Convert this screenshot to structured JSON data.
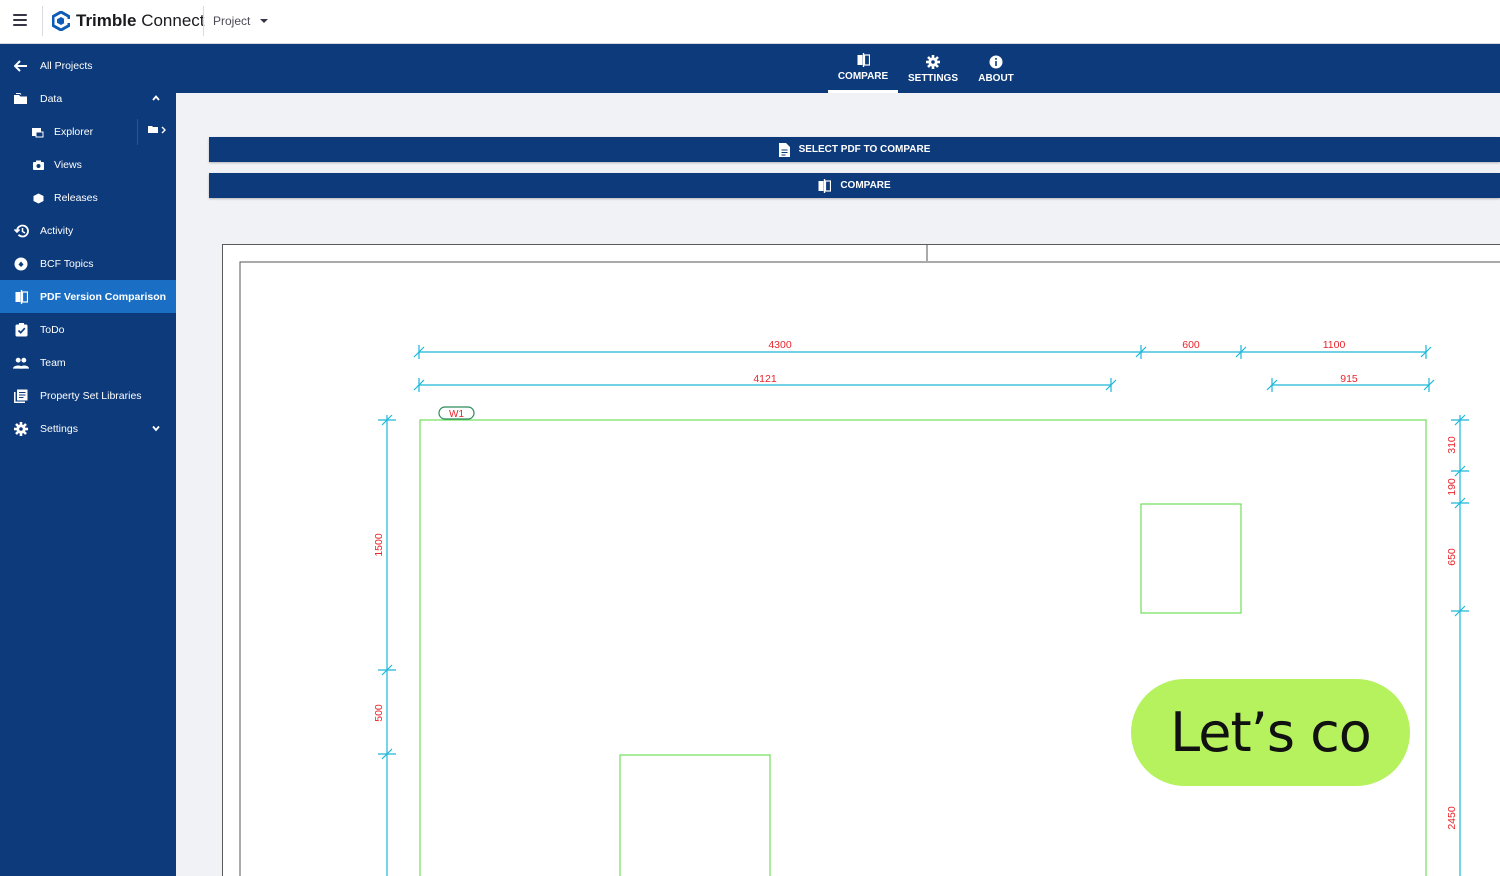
{
  "header": {
    "brand_strong": "Trimble",
    "brand_light": " Connect",
    "project_label": "Project"
  },
  "sidebar": {
    "items": [
      {
        "label": "All Projects",
        "icon": "arrow-left-icon"
      },
      {
        "label": "Data",
        "icon": "folder-icon"
      },
      {
        "label": "Explorer",
        "icon": "explorer-icon"
      },
      {
        "label": "Views",
        "icon": "camera-icon"
      },
      {
        "label": "Releases",
        "icon": "box-icon"
      },
      {
        "label": "Activity",
        "icon": "history-icon"
      },
      {
        "label": "BCF Topics",
        "icon": "bcf-icon"
      },
      {
        "label": "PDF Version Comparison",
        "icon": "compare-icon"
      },
      {
        "label": "ToDo",
        "icon": "checkbox-icon"
      },
      {
        "label": "Team",
        "icon": "team-icon"
      },
      {
        "label": "Property Set Libraries",
        "icon": "library-icon"
      },
      {
        "label": "Settings",
        "icon": "gear-icon"
      }
    ],
    "active_item": "PDF Version Comparison"
  },
  "toolbar": {
    "tabs": [
      {
        "label": "COMPARE",
        "icon": "compare-icon"
      },
      {
        "label": "SETTINGS",
        "icon": "gear-icon"
      },
      {
        "label": "ABOUT",
        "icon": "info-icon"
      }
    ],
    "active_tab": "COMPARE"
  },
  "actions": {
    "select_pdf": "SELECT PDF TO COMPARE",
    "compare": "COMPARE"
  },
  "drawing": {
    "dim_top_1": [
      "4300",
      "600",
      "1100"
    ],
    "dim_top_2": [
      "4121",
      "915"
    ],
    "dim_left": [
      "1500",
      "500"
    ],
    "dim_right": [
      "310",
      "190",
      "650",
      "2450"
    ],
    "tag": "W1"
  },
  "promo": {
    "text": "Let’s co"
  },
  "colors": {
    "navy": "#0d3a7a",
    "active_blue": "#1a6fc4",
    "dimension_cyan": "#1cb8d8",
    "dimension_text": "#e8242b",
    "outline_green": "#6ee05a",
    "promo_green": "#b6f25e"
  }
}
